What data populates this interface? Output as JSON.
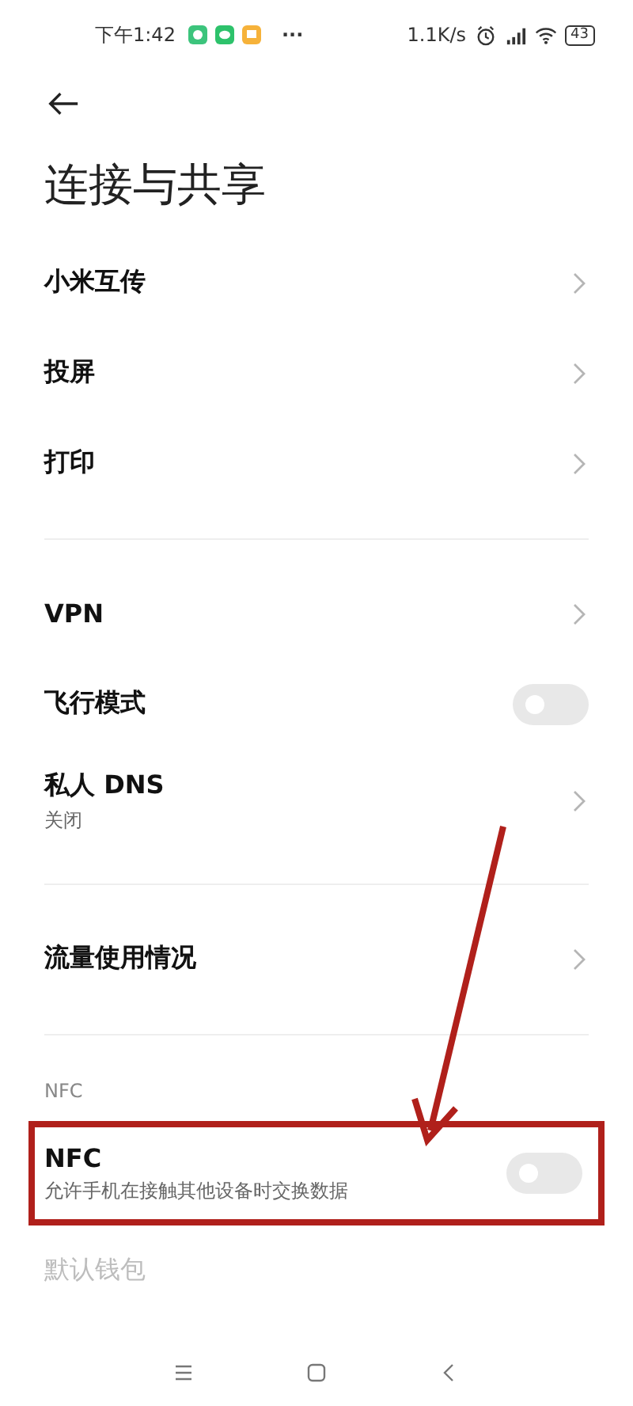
{
  "status_bar": {
    "time": "下午1:42",
    "more": "···",
    "speed": "1.1K/s",
    "battery": "43"
  },
  "title": "连接与共享",
  "groups": [
    {
      "items": [
        {
          "kind": "link",
          "title": "小米互传"
        },
        {
          "kind": "link",
          "title": "投屏"
        },
        {
          "kind": "link",
          "title": "打印"
        }
      ]
    },
    {
      "items": [
        {
          "kind": "link",
          "title": "VPN"
        },
        {
          "kind": "toggle",
          "title": "飞行模式",
          "on": false
        },
        {
          "kind": "link",
          "title": "私人 DNS",
          "subtitle": "关闭"
        }
      ]
    },
    {
      "items": [
        {
          "kind": "link",
          "title": "流量使用情况"
        }
      ]
    },
    {
      "header": "NFC",
      "items": [
        {
          "kind": "toggle",
          "title": "NFC",
          "subtitle": "允许手机在接触其他设备时交换数据",
          "on": false,
          "highlighted": true
        },
        {
          "kind": "plain",
          "title": "默认钱包",
          "disabled": true
        }
      ]
    }
  ]
}
